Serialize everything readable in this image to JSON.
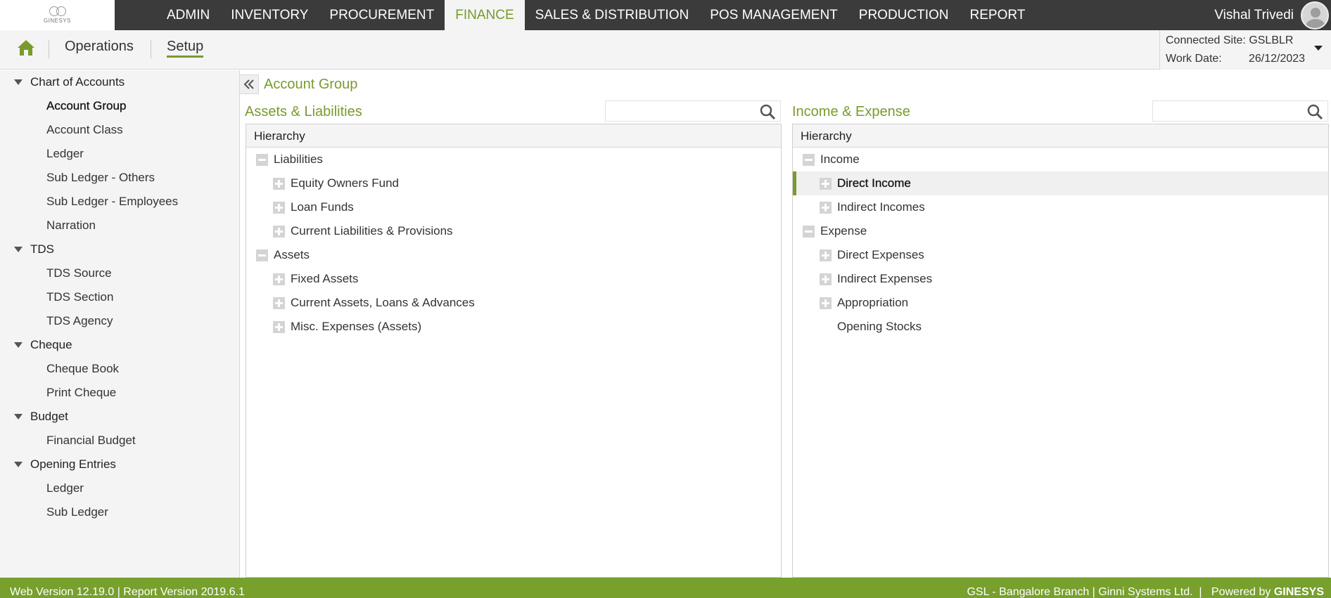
{
  "logo": {
    "text": "GINESYS"
  },
  "nav": {
    "items": [
      {
        "label": "ADMIN",
        "active": false
      },
      {
        "label": "INVENTORY",
        "active": false
      },
      {
        "label": "PROCUREMENT",
        "active": false
      },
      {
        "label": "FINANCE",
        "active": true
      },
      {
        "label": "SALES & DISTRIBUTION",
        "active": false
      },
      {
        "label": "POS MANAGEMENT",
        "active": false
      },
      {
        "label": "PRODUCTION",
        "active": false
      },
      {
        "label": "REPORT",
        "active": false
      }
    ]
  },
  "user": {
    "name": "Vishal Trivedi"
  },
  "subnav": {
    "operations": "Operations",
    "setup": "Setup"
  },
  "site": {
    "connected_label": "Connected Site:",
    "connected_value": "GSLBLR",
    "workdate_label": "Work Date:",
    "workdate_value": "26/12/2023"
  },
  "sidebar": {
    "groups": [
      {
        "label": "Chart of Accounts",
        "items": [
          "Account Group",
          "Account Class",
          "Ledger",
          "Sub Ledger - Others",
          "Sub Ledger - Employees",
          "Narration"
        ]
      },
      {
        "label": "TDS",
        "items": [
          "TDS Source",
          "TDS Section",
          "TDS Agency"
        ]
      },
      {
        "label": "Cheque",
        "items": [
          "Cheque Book",
          "Print Cheque"
        ]
      },
      {
        "label": "Budget",
        "items": [
          "Financial Budget"
        ]
      },
      {
        "label": "Opening Entries",
        "items": [
          "Ledger",
          "Sub Ledger"
        ]
      }
    ],
    "active_item": "Account Group"
  },
  "page": {
    "title": "Account Group"
  },
  "left_panel": {
    "title": "Assets & Liabilities",
    "search_value": "",
    "column": "Hierarchy",
    "tree": [
      {
        "label": "Liabilities",
        "level": 0,
        "state": "minus"
      },
      {
        "label": "Equity Owners Fund",
        "level": 1,
        "state": "plus"
      },
      {
        "label": "Loan Funds",
        "level": 1,
        "state": "plus"
      },
      {
        "label": "Current Liabilities & Provisions",
        "level": 1,
        "state": "plus"
      },
      {
        "label": "Assets",
        "level": 0,
        "state": "minus"
      },
      {
        "label": "Fixed Assets",
        "level": 1,
        "state": "plus"
      },
      {
        "label": "Current Assets, Loans & Advances",
        "level": 1,
        "state": "plus"
      },
      {
        "label": "Misc. Expenses (Assets)",
        "level": 1,
        "state": "plus"
      }
    ]
  },
  "right_panel": {
    "title": "Income & Expense",
    "search_value": "",
    "column": "Hierarchy",
    "tree": [
      {
        "label": "Income",
        "level": 0,
        "state": "minus"
      },
      {
        "label": "Direct Income",
        "level": 1,
        "state": "plus",
        "selected": true
      },
      {
        "label": "Indirect Incomes",
        "level": 1,
        "state": "plus"
      },
      {
        "label": "Expense",
        "level": 0,
        "state": "minus"
      },
      {
        "label": "Direct Expenses",
        "level": 1,
        "state": "plus"
      },
      {
        "label": "Indirect Expenses",
        "level": 1,
        "state": "plus"
      },
      {
        "label": "Appropriation",
        "level": 1,
        "state": "plus"
      },
      {
        "label": "Opening Stocks",
        "level": 1,
        "state": "none"
      }
    ]
  },
  "footer": {
    "left": "Web Version 12.19.0 | Report Version 2019.6.1",
    "right": "GSL - Bangalore Branch | Ginni Systems Ltd.  |   Powered by ",
    "brand": "GINESYS"
  },
  "colors": {
    "accent": "#7a9a2e",
    "footer": "#77a02d",
    "topbar": "#3b3b3b"
  }
}
